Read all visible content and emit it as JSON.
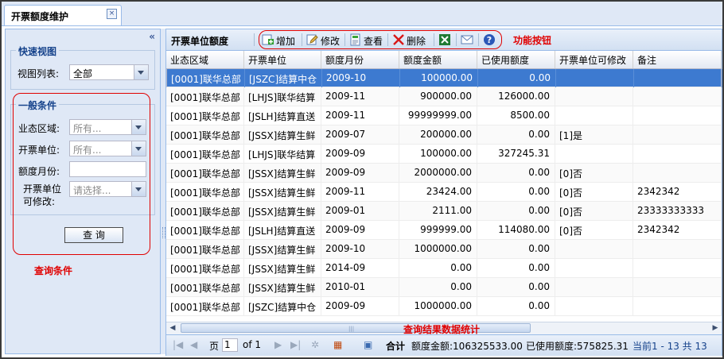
{
  "tab": {
    "title": "开票额度维护",
    "close": "×"
  },
  "left": {
    "collapse": "«",
    "quick_view": {
      "legend": "快速视图",
      "view_list_label": "视图列表:",
      "view_list_value": "全部"
    },
    "conditions": {
      "legend": "一般条件",
      "region_label": "业态区域:",
      "region_placeholder": "所有...",
      "unit_label": "开票单位:",
      "unit_placeholder": "所有...",
      "month_label": "额度月份:",
      "month_value": "",
      "modifiable_label_1": "开票单位",
      "modifiable_label_2": "可修改:",
      "modifiable_placeholder": "请选择...",
      "query_button": "查 询"
    },
    "annotation": "查询条件"
  },
  "grid": {
    "title": "开票单位额度",
    "toolbar": {
      "add": "增加",
      "edit": "修改",
      "view": "查看",
      "delete": "删除"
    },
    "toolbar_annotation": "功能按钮",
    "columns": [
      "业态区域",
      "开票单位",
      "额度月份",
      "额度金额",
      "已使用额度",
      "开票单位可修改",
      "备注"
    ],
    "rows": [
      [
        "[0001]联华总部",
        "[JSZC]结算中仓",
        "2009-10",
        "100000.00",
        "0.00",
        "",
        ""
      ],
      [
        "[0001]联华总部",
        "[LHJS]联华结算",
        "2009-11",
        "900000.00",
        "126000.00",
        "",
        ""
      ],
      [
        "[0001]联华总部",
        "[JSLH]结算直送",
        "2009-11",
        "99999999.00",
        "8500.00",
        "",
        ""
      ],
      [
        "[0001]联华总部",
        "[JSSX]结算生鲜",
        "2009-07",
        "200000.00",
        "0.00",
        "[1]是",
        ""
      ],
      [
        "[0001]联华总部",
        "[LHJS]联华结算",
        "2009-09",
        "100000.00",
        "327245.31",
        "",
        ""
      ],
      [
        "[0001]联华总部",
        "[JSSX]结算生鲜",
        "2009-09",
        "2000000.00",
        "0.00",
        "[0]否",
        ""
      ],
      [
        "[0001]联华总部",
        "[JSSX]结算生鲜",
        "2009-11",
        "23424.00",
        "0.00",
        "[0]否",
        "2342342"
      ],
      [
        "[0001]联华总部",
        "[JSSX]结算生鲜",
        "2009-01",
        "2111.00",
        "0.00",
        "[0]否",
        "23333333333"
      ],
      [
        "[0001]联华总部",
        "[JSLH]结算直送",
        "2009-09",
        "999999.00",
        "114080.00",
        "[0]否",
        "2342342"
      ],
      [
        "[0001]联华总部",
        "[JSSX]结算生鲜",
        "2009-10",
        "1000000.00",
        "0.00",
        "",
        ""
      ],
      [
        "[0001]联华总部",
        "[JSSX]结算生鲜",
        "2014-09",
        "0.00",
        "0.00",
        "",
        ""
      ],
      [
        "[0001]联华总部",
        "[JSSX]结算生鲜",
        "2010-01",
        "0.00",
        "0.00",
        "",
        ""
      ],
      [
        "[0001]联华总部",
        "[JSZC]结算中仓",
        "2009-09",
        "1000000.00",
        "0.00",
        "",
        ""
      ]
    ],
    "selected_row": 0,
    "scroll_annotation": "查询结果数据统计",
    "pager": {
      "page_label": "页",
      "page_value": "1",
      "of_label": "of 1",
      "summary_label": "合计",
      "amount_total": "额度金额:106325533.00",
      "used_total": "已使用额度:575825.31",
      "range": "当前1 - 13 共 13"
    }
  },
  "colors": {
    "accent": "#3d7ad0",
    "annotation": "#e00000",
    "panel": "#dfe8f6"
  }
}
